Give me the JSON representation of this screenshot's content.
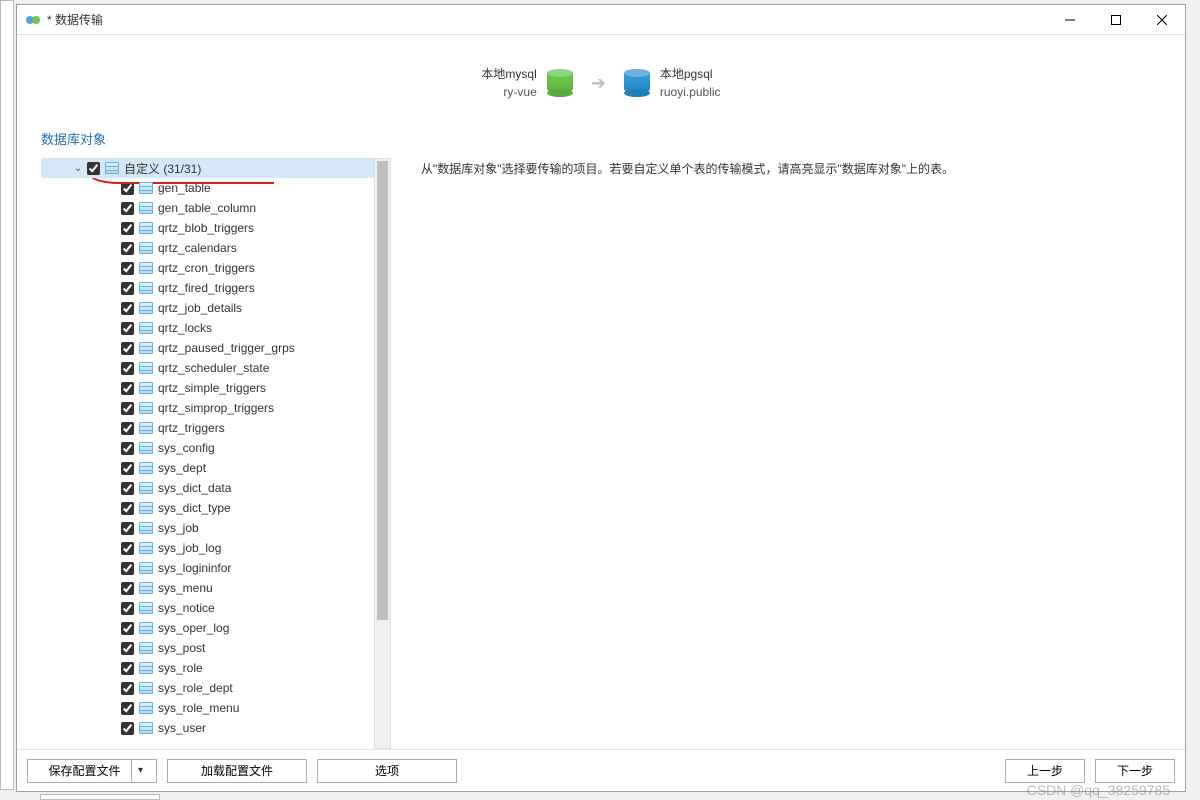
{
  "window": {
    "title": "* 数据传输"
  },
  "transfer": {
    "source": {
      "line1": "本地mysql",
      "line2": "ry-vue"
    },
    "target": {
      "line1": "本地pgsql",
      "line2": "ruoyi.public"
    }
  },
  "section_title": "数据库对象",
  "description": "从\"数据库对象\"选择要传输的项目。若要自定义单个表的传输模式，请高亮显示\"数据库对象\"上的表。",
  "tree": {
    "root": {
      "label": "自定义 (31/31)",
      "expanded": true,
      "checked": true
    },
    "items": [
      {
        "label": "gen_table",
        "checked": true
      },
      {
        "label": "gen_table_column",
        "checked": true
      },
      {
        "label": "qrtz_blob_triggers",
        "checked": true
      },
      {
        "label": "qrtz_calendars",
        "checked": true
      },
      {
        "label": "qrtz_cron_triggers",
        "checked": true
      },
      {
        "label": "qrtz_fired_triggers",
        "checked": true
      },
      {
        "label": "qrtz_job_details",
        "checked": true
      },
      {
        "label": "qrtz_locks",
        "checked": true
      },
      {
        "label": "qrtz_paused_trigger_grps",
        "checked": true
      },
      {
        "label": "qrtz_scheduler_state",
        "checked": true
      },
      {
        "label": "qrtz_simple_triggers",
        "checked": true
      },
      {
        "label": "qrtz_simprop_triggers",
        "checked": true
      },
      {
        "label": "qrtz_triggers",
        "checked": true
      },
      {
        "label": "sys_config",
        "checked": true
      },
      {
        "label": "sys_dept",
        "checked": true
      },
      {
        "label": "sys_dict_data",
        "checked": true
      },
      {
        "label": "sys_dict_type",
        "checked": true
      },
      {
        "label": "sys_job",
        "checked": true
      },
      {
        "label": "sys_job_log",
        "checked": true
      },
      {
        "label": "sys_logininfor",
        "checked": true
      },
      {
        "label": "sys_menu",
        "checked": true
      },
      {
        "label": "sys_notice",
        "checked": true
      },
      {
        "label": "sys_oper_log",
        "checked": true
      },
      {
        "label": "sys_post",
        "checked": true
      },
      {
        "label": "sys_role",
        "checked": true
      },
      {
        "label": "sys_role_dept",
        "checked": true
      },
      {
        "label": "sys_role_menu",
        "checked": true
      },
      {
        "label": "sys_user",
        "checked": true
      }
    ]
  },
  "buttons": {
    "save_config": "保存配置文件",
    "load_config": "加载配置文件",
    "options": "选项",
    "prev": "上一步",
    "next": "下一步"
  },
  "watermark": "CSDN @qq_38259785"
}
